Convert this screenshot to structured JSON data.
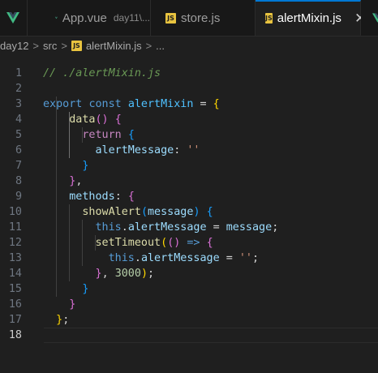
{
  "tabs": [
    {
      "label": "App.vue",
      "description": "day11\\...",
      "icon": "vue-icon",
      "active": false
    },
    {
      "label": "store.js",
      "icon": "js-icon",
      "active": false
    },
    {
      "label": "alertMixin.js",
      "icon": "js-icon",
      "active": true,
      "close": "✕"
    }
  ],
  "breadcrumb": {
    "items": [
      "day12",
      "src",
      "alertMixin.js",
      "..."
    ],
    "separator": ">"
  },
  "editor": {
    "current_line": 18,
    "lines": [
      {
        "n": "1",
        "tokens": [
          [
            "c-com",
            "// ./alertMixin.js"
          ]
        ]
      },
      {
        "n": "2",
        "tokens": []
      },
      {
        "n": "3",
        "tokens": [
          [
            "c-kw",
            "export"
          ],
          [
            "c-op",
            " "
          ],
          [
            "c-kw",
            "const"
          ],
          [
            "c-op",
            " "
          ],
          [
            "c-const",
            "alertMixin"
          ],
          [
            "c-op",
            " = "
          ],
          [
            "b1",
            "{"
          ]
        ]
      },
      {
        "n": "4",
        "tokens": [
          [
            "c-op",
            "    "
          ],
          [
            "c-fn",
            "data"
          ],
          [
            "b2",
            "()"
          ],
          [
            "c-op",
            " "
          ],
          [
            "b2",
            "{"
          ]
        ]
      },
      {
        "n": "5",
        "tokens": [
          [
            "c-op",
            "      "
          ],
          [
            "c-ctl",
            "return"
          ],
          [
            "c-op",
            " "
          ],
          [
            "b3",
            "{"
          ]
        ]
      },
      {
        "n": "6",
        "tokens": [
          [
            "c-op",
            "        "
          ],
          [
            "c-var",
            "alertMessage"
          ],
          [
            "c-op",
            ": "
          ],
          [
            "c-str",
            "''"
          ]
        ]
      },
      {
        "n": "7",
        "tokens": [
          [
            "c-op",
            "      "
          ],
          [
            "b3",
            "}"
          ]
        ]
      },
      {
        "n": "8",
        "tokens": [
          [
            "c-op",
            "    "
          ],
          [
            "b2",
            "}"
          ],
          [
            "c-op",
            ","
          ]
        ]
      },
      {
        "n": "9",
        "tokens": [
          [
            "c-op",
            "    "
          ],
          [
            "c-var",
            "methods"
          ],
          [
            "c-op",
            ": "
          ],
          [
            "b2",
            "{"
          ]
        ]
      },
      {
        "n": "10",
        "tokens": [
          [
            "c-op",
            "      "
          ],
          [
            "c-fn",
            "showAlert"
          ],
          [
            "b3",
            "("
          ],
          [
            "c-var",
            "message"
          ],
          [
            "b3",
            ")"
          ],
          [
            "c-op",
            " "
          ],
          [
            "b3",
            "{"
          ]
        ]
      },
      {
        "n": "11",
        "tokens": [
          [
            "c-op",
            "        "
          ],
          [
            "c-kw",
            "this"
          ],
          [
            "c-op",
            "."
          ],
          [
            "c-var",
            "alertMessage"
          ],
          [
            "c-op",
            " = "
          ],
          [
            "c-var",
            "message"
          ],
          [
            "c-op",
            ";"
          ]
        ]
      },
      {
        "n": "12",
        "tokens": [
          [
            "c-op",
            "        "
          ],
          [
            "c-fn",
            "setTimeout"
          ],
          [
            "b1",
            "("
          ],
          [
            "b2",
            "()"
          ],
          [
            "c-op",
            " "
          ],
          [
            "c-kw",
            "=>"
          ],
          [
            "c-op",
            " "
          ],
          [
            "b2",
            "{"
          ]
        ]
      },
      {
        "n": "13",
        "tokens": [
          [
            "c-op",
            "          "
          ],
          [
            "c-kw",
            "this"
          ],
          [
            "c-op",
            "."
          ],
          [
            "c-var",
            "alertMessage"
          ],
          [
            "c-op",
            " = "
          ],
          [
            "c-str",
            "''"
          ],
          [
            "c-op",
            ";"
          ]
        ]
      },
      {
        "n": "14",
        "tokens": [
          [
            "c-op",
            "        "
          ],
          [
            "b2",
            "}"
          ],
          [
            "c-op",
            ", "
          ],
          [
            "c-num",
            "3000"
          ],
          [
            "b1",
            ")"
          ],
          [
            "c-op",
            ";"
          ]
        ]
      },
      {
        "n": "15",
        "tokens": [
          [
            "c-op",
            "      "
          ],
          [
            "b3",
            "}"
          ]
        ]
      },
      {
        "n": "16",
        "tokens": [
          [
            "c-op",
            "    "
          ],
          [
            "b2",
            "}"
          ]
        ]
      },
      {
        "n": "17",
        "tokens": [
          [
            "c-op",
            "  "
          ],
          [
            "b1",
            "}"
          ],
          [
            "c-op",
            ";"
          ]
        ]
      },
      {
        "n": "18",
        "tokens": []
      }
    ]
  }
}
